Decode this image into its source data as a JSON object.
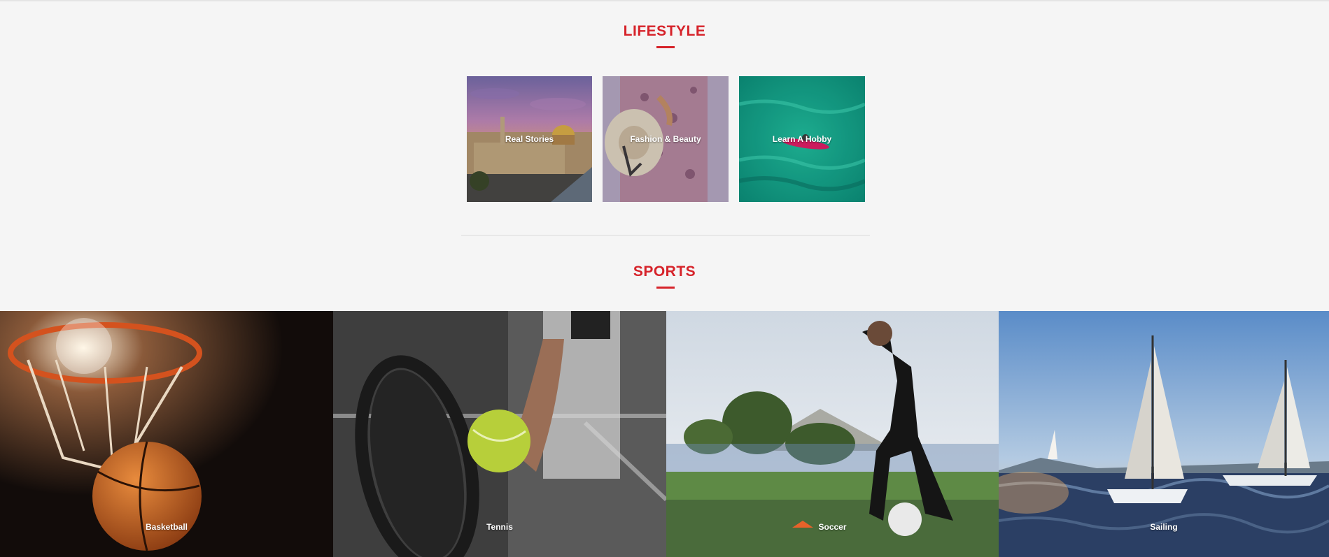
{
  "lifestyle": {
    "title": "LIFESTYLE",
    "items": [
      {
        "label": "Real Stories"
      },
      {
        "label": "Fashion & Beauty"
      },
      {
        "label": "Learn A Hobby"
      }
    ]
  },
  "sports": {
    "title": "SPORTS",
    "items": [
      {
        "label": "Basketball"
      },
      {
        "label": "Tennis"
      },
      {
        "label": "Soccer"
      },
      {
        "label": "Sailing"
      }
    ]
  },
  "colors": {
    "accent": "#d6232a",
    "background": "#f5f5f5"
  }
}
